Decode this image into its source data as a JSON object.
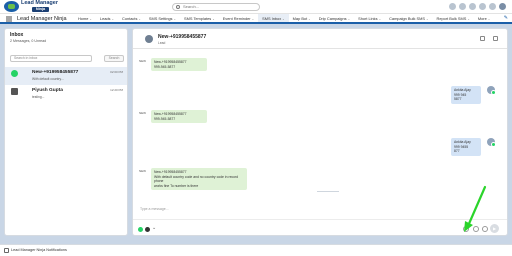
{
  "header": {
    "brand_line1": "Lead Manager",
    "brand_line2": "Ninja",
    "search_placeholder": "Search..."
  },
  "nav": {
    "app_name": "Lead Manager Ninja",
    "tabs": [
      {
        "label": "Home",
        "active": false
      },
      {
        "label": "Leads",
        "active": false
      },
      {
        "label": "Contacts",
        "active": false
      },
      {
        "label": "SMS Settings",
        "active": false
      },
      {
        "label": "SMS Templates",
        "active": false
      },
      {
        "label": "Event Reminder",
        "active": false
      },
      {
        "label": "SMS Inbox",
        "active": true
      },
      {
        "label": "Map Bot",
        "active": false
      },
      {
        "label": "Drip Campaigns",
        "active": false
      },
      {
        "label": "Short Links",
        "active": false
      },
      {
        "label": "Campaign Bulk SMS",
        "active": false
      },
      {
        "label": "Report Bulk SMS",
        "active": false
      },
      {
        "label": "More",
        "active": false
      }
    ]
  },
  "inbox": {
    "title": "Inbox",
    "subtitle": "2 Messages, 0 Unread",
    "search_placeholder": "Search in inbox",
    "search_button": "Search",
    "conversations": [
      {
        "name": "New-+919958455877",
        "preview": "With default country...",
        "time": "02:00 PM",
        "channel": "whatsapp",
        "selected": true
      },
      {
        "name": "Piyush Gupta",
        "preview": "testing...",
        "time": "12:20 PM",
        "channel": "email",
        "selected": false
      }
    ]
  },
  "chat": {
    "name": "New-+919958455877",
    "tag": "Lead",
    "messages": [
      {
        "dir": "in",
        "avatar_label": "NEW",
        "lines": [
          "New-+919958455877",
          "999-945-5877"
        ]
      },
      {
        "dir": "out",
        "lines": [
          "Ankita Ajay",
          "999 945",
          "5877"
        ]
      },
      {
        "dir": "in",
        "avatar_label": "NEW",
        "lines": [
          "New-+919958455877",
          "999-945-5877"
        ]
      },
      {
        "dir": "out",
        "lines": [
          "Ankita Ajay",
          "999 9455",
          "877"
        ]
      },
      {
        "dir": "in",
        "avatar_label": "NEW",
        "lines": [
          "New-+919958455877",
          "With default country code and no country code in record phone",
          "works fine To number is there"
        ]
      }
    ],
    "composer_placeholder": "Type a message...",
    "send_glyph": "▶"
  },
  "footer": {
    "label": "Lead Manager Ninja Notifications"
  },
  "colors": {
    "accent": "#1b5fa8",
    "incoming_bubble": "#dff2d6",
    "outgoing_bubble": "#d3e3f6",
    "whatsapp": "#25d366",
    "annotation_arrow": "#2bd42b"
  }
}
